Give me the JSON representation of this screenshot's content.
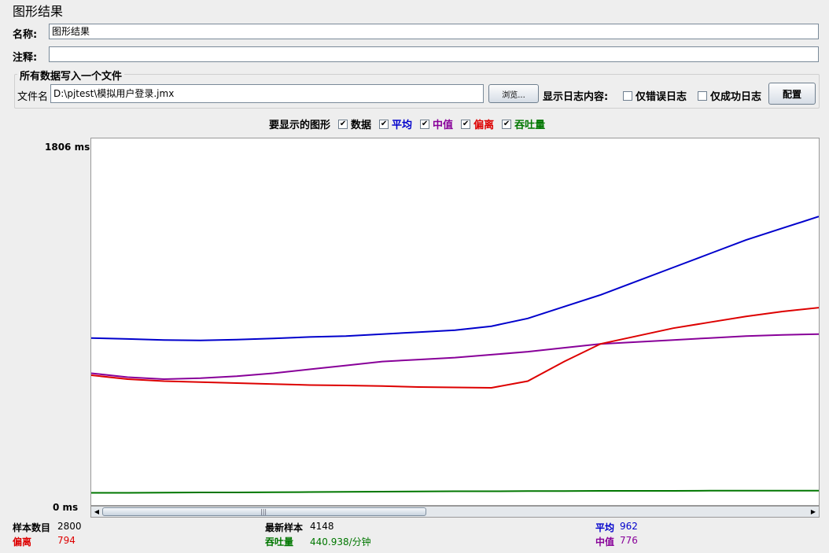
{
  "window": {
    "title": "图形结果"
  },
  "form": {
    "name_label": "名称:",
    "name_value": "图形结果",
    "comment_label": "注释:",
    "comment_value": "",
    "group_title": "所有数据写入一个文件",
    "file_label": "文件名",
    "file_value": "D:\\pjtest\\模拟用户登录.jmx",
    "browse_label": "浏览...",
    "log_display_label": "显示日志内容:",
    "errors_only_label": "仅错误日志",
    "success_only_label": "仅成功日志",
    "configure_label": "配置"
  },
  "legend": {
    "prompt": "要显示的图形",
    "items": [
      {
        "label": "数据",
        "color": "#000000",
        "checked": true
      },
      {
        "label": "平均",
        "color": "#0000cc",
        "checked": true
      },
      {
        "label": "中值",
        "color": "#880099",
        "checked": true
      },
      {
        "label": "偏离",
        "color": "#dd0000",
        "checked": true
      },
      {
        "label": "吞吐量",
        "color": "#007700",
        "checked": true
      }
    ]
  },
  "chart_data": {
    "type": "line",
    "y_axis": {
      "max_label": "1806  ms",
      "min_label": "0  ms",
      "ylim": [
        0,
        1806
      ]
    },
    "x": [
      0,
      5,
      10,
      15,
      20,
      25,
      30,
      35,
      40,
      45,
      50,
      55,
      60,
      65,
      70,
      75,
      80,
      85,
      90,
      95,
      100
    ],
    "series": [
      {
        "name": "平均",
        "color": "#0000cc",
        "values": [
          820,
          815,
          810,
          808,
          812,
          818,
          825,
          830,
          840,
          850,
          860,
          880,
          920,
          980,
          1040,
          1110,
          1180,
          1250,
          1320,
          1380,
          1440
        ]
      },
      {
        "name": "中值",
        "color": "#880099",
        "values": [
          640,
          620,
          610,
          615,
          625,
          640,
          660,
          680,
          700,
          710,
          720,
          735,
          750,
          770,
          790,
          800,
          810,
          820,
          830,
          836,
          840
        ]
      },
      {
        "name": "偏离",
        "color": "#dd0000",
        "values": [
          630,
          610,
          600,
          595,
          590,
          585,
          580,
          578,
          575,
          570,
          568,
          566,
          600,
          700,
          790,
          830,
          870,
          900,
          930,
          955,
          975
        ]
      },
      {
        "name": "吞吐量",
        "color": "#007700",
        "values": [
          30,
          30,
          31,
          32,
          32,
          33,
          34,
          35,
          36,
          37,
          38,
          38,
          39,
          39,
          40,
          40,
          40,
          41,
          41,
          41,
          41
        ]
      }
    ]
  },
  "stats": {
    "samples_label": "样本数目",
    "samples_value": "2800",
    "latest_label": "最新样本",
    "latest_value": "4148",
    "average_label": "平均",
    "average_value": "962",
    "deviation_label": "偏离",
    "deviation_value": "794",
    "throughput_label": "吞吐量",
    "throughput_value": "440.938/分钟",
    "median_label": "中值",
    "median_value": "776"
  },
  "colors": {
    "average": "#0000cc",
    "median": "#880099",
    "deviation": "#dd0000",
    "throughput": "#007700",
    "data": "#000000"
  },
  "icons": {
    "check": "check-icon",
    "scroll_left": "arrow-left-icon",
    "scroll_right": "arrow-right-icon",
    "grip": "grip-icon"
  }
}
